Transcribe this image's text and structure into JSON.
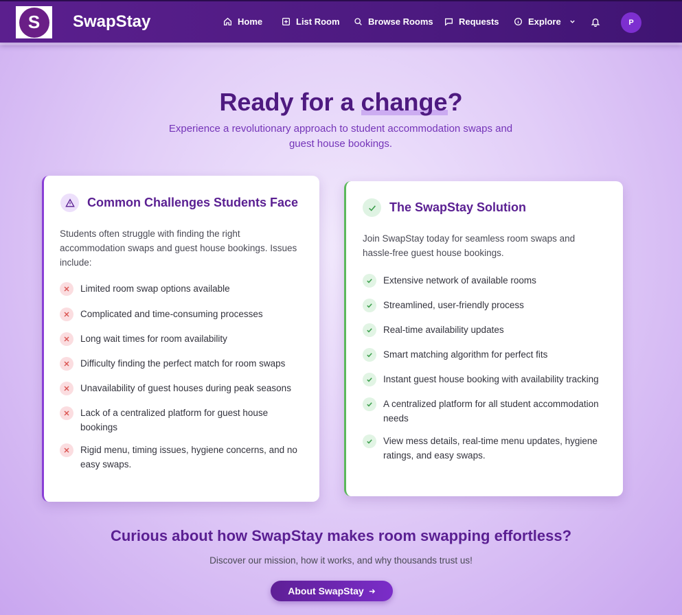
{
  "brand": {
    "logo_letter": "S",
    "name": "SwapStay"
  },
  "nav": {
    "items": [
      {
        "label": "Home",
        "icon": "home-icon"
      },
      {
        "label": "List Room",
        "icon": "plus-square-icon"
      },
      {
        "label": "Browse Rooms",
        "icon": "search-icon"
      },
      {
        "label": "Requests",
        "icon": "chat-icon"
      },
      {
        "label": "Explore",
        "icon": "info-icon"
      }
    ],
    "explore_chevron": "chevron-down-icon",
    "bell_icon": "bell-icon",
    "avatar_initial": "P"
  },
  "hero": {
    "title_prefix": "Ready for a ",
    "title_highlight": "change",
    "title_suffix": "?",
    "subtitle": "Experience a revolutionary approach to student accommodation swaps and guest house bookings."
  },
  "challenges": {
    "title": "Common Challenges Students Face",
    "intro": "Students often struggle with finding the right accommodation swaps and guest house bookings. Issues include:",
    "items": [
      "Limited room swap options available",
      "Complicated and time-consuming processes",
      "Long wait times for room availability",
      "Difficulty finding the perfect match for room swaps",
      "Unavailability of guest houses during peak seasons",
      "Lack of a centralized platform for guest house bookings",
      "Rigid menu, timing issues, hygiene concerns, and no easy swaps."
    ]
  },
  "solution": {
    "title": "The SwapStay Solution",
    "intro": "Join SwapStay today for seamless room swaps and hassle-free guest house bookings.",
    "items": [
      "Extensive network of available rooms",
      "Streamlined, user-friendly process",
      "Real-time availability updates",
      "Smart matching algorithm for perfect fits",
      "Instant guest house booking with availability tracking",
      "A centralized platform for all student accommodation needs",
      "View mess details, real-time menu updates, hygiene ratings, and easy swaps."
    ]
  },
  "cta": {
    "title": "Curious about how SwapStay makes room swapping effortless?",
    "subtitle": "Discover our mission, how it works, and why thousands trust us!",
    "button_label": "About SwapStay",
    "button_icon": "arrow-right-icon"
  },
  "colors": {
    "nav_bg": "#4c1a80",
    "accent": "#5a1f92",
    "challenge_border": "#8a3fd6",
    "solution_border": "#5cb85c",
    "error_red": "#d9534f",
    "success_green": "#3a9d4a"
  }
}
